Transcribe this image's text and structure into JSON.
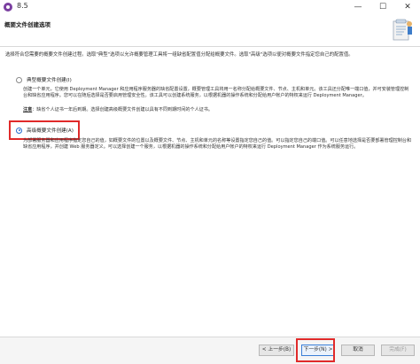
{
  "window": {
    "title": "8.5",
    "controls": {
      "minimize": "—",
      "maximize": "☐",
      "close": "✕"
    }
  },
  "header": {
    "title": "概要文件创建选项",
    "graphic_icon": "wizard-graphic-icon"
  },
  "intro": "选择符合您需要的概要文件创建过程。选取\"典型\"选项以允许概要管理工具将一组缺省配置值分配给概要文件。选取\"高级\"选项以便对概要文件指定您自己的配置值。",
  "options": [
    {
      "label": "典型概要文件创建(I)",
      "selected": false,
      "description": "创建一个单元，它使用 Deployment Manager 和应用程序服务器的缺省配置设置，概要管理工具将用一名称分配给概要文件、节点、主机和单元。该工具还分配唯一端口值，并可安装管理控制台和缺省应用程序。您可以在随后选择是否要启用管理安全性。该工具可以创建系统服务，以根据机器的操作系统和分配给用户帐户的特权来运行 Deployment Manager。",
      "note_label": "注意",
      "note_text": "：缺省个人证书一年后到期。选择创建高级概要文件创建以具有不同到期时间的个人证书。"
    },
    {
      "label": "高级概要文件创建(A)",
      "selected": true,
      "description": "为部署服务器和应用程序指定您自己的值，如概要文件的位置以及概要文件、节点、主机和单元的名称等设置指定您自己的值。可以指定您自己的端口值。可以任意地选择是否要部署管理控制台和缺省应用程序，并创建 Web 服务器定义。可以选择创建一个服务，以根据机器的操作系统和分配给用户帐户的特权来运行 Deployment Manager 作为系统服务运行。"
    }
  ],
  "buttons": {
    "back": "< 上一步(B)",
    "next": "下一步(N) >",
    "cancel": "取消",
    "finish": "完成(F)"
  },
  "colors": {
    "highlight_box": "#e02a2a",
    "selected_radio": "#2a6fd0"
  }
}
